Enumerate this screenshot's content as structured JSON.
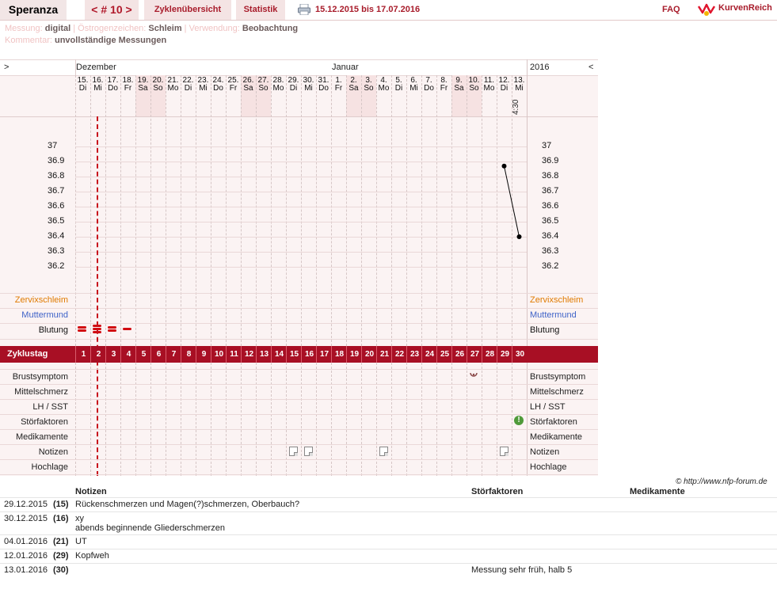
{
  "nav": {
    "brand": "Speranza",
    "cycle": "< # 10 >",
    "tabs": [
      "Zyklenübersicht",
      "Statistik"
    ],
    "date_range": "15.12.2015 bis 17.07.2016",
    "faq": "FAQ",
    "logo_text": "KurvenReich"
  },
  "info": {
    "messung_label": "Messung:",
    "messung_value": "digital",
    "oestrogen_label": "Östrogenzeichen:",
    "oestrogen_value": "Schleim",
    "verwendung_label": "Verwendung:",
    "verwendung_value": "Beobachtung",
    "kommentar_label": "Kommentar:",
    "kommentar_value": "unvollständige Messungen"
  },
  "chart": {
    "nav_prev": ">",
    "nav_next": "<",
    "month_dec": "Dezember",
    "month_jan": "Januar",
    "year": "2016",
    "time_label": "4:30",
    "days": [
      {
        "d": "15.",
        "w": "Di"
      },
      {
        "d": "16.",
        "w": "Mi"
      },
      {
        "d": "17.",
        "w": "Do"
      },
      {
        "d": "18.",
        "w": "Fr"
      },
      {
        "d": "19.",
        "w": "Sa"
      },
      {
        "d": "20.",
        "w": "So"
      },
      {
        "d": "21.",
        "w": "Mo"
      },
      {
        "d": "22.",
        "w": "Di"
      },
      {
        "d": "23.",
        "w": "Mi"
      },
      {
        "d": "24.",
        "w": "Do"
      },
      {
        "d": "25.",
        "w": "Fr"
      },
      {
        "d": "26.",
        "w": "Sa"
      },
      {
        "d": "27.",
        "w": "So"
      },
      {
        "d": "28.",
        "w": "Mo"
      },
      {
        "d": "29.",
        "w": "Di"
      },
      {
        "d": "30.",
        "w": "Mi"
      },
      {
        "d": "31.",
        "w": "Do"
      },
      {
        "d": "1.",
        "w": "Fr"
      },
      {
        "d": "2.",
        "w": "Sa"
      },
      {
        "d": "3.",
        "w": "So"
      },
      {
        "d": "4.",
        "w": "Mo"
      },
      {
        "d": "5.",
        "w": "Di"
      },
      {
        "d": "6.",
        "w": "Mi"
      },
      {
        "d": "7.",
        "w": "Do"
      },
      {
        "d": "8.",
        "w": "Fr"
      },
      {
        "d": "9.",
        "w": "Sa"
      },
      {
        "d": "10.",
        "w": "So"
      },
      {
        "d": "11.",
        "w": "Mo"
      },
      {
        "d": "12.",
        "w": "Di"
      },
      {
        "d": "13.",
        "w": "Mi"
      }
    ],
    "weekend_days": [
      5,
      6,
      12,
      13,
      19,
      20,
      26,
      27
    ],
    "temp_ticks": [
      "37",
      "36.9",
      "36.8",
      "36.7",
      "36.6",
      "36.5",
      "36.4",
      "36.3",
      "36.2"
    ],
    "temperatures": [
      {
        "day": 29,
        "temp": 36.87
      },
      {
        "day": 30,
        "temp": 36.4
      }
    ],
    "row_labels_top": [
      "Zervixschleim",
      "Muttermund",
      "Blutung"
    ],
    "zyklustag_label": "Zyklustag",
    "cycle_days": [
      "1",
      "2",
      "3",
      "4",
      "5",
      "6",
      "7",
      "8",
      "9",
      "10",
      "11",
      "12",
      "13",
      "14",
      "15",
      "16",
      "17",
      "18",
      "19",
      "20",
      "21",
      "22",
      "23",
      "24",
      "25",
      "26",
      "27",
      "28",
      "29",
      "30"
    ],
    "row_labels_bottom": [
      "Brustsymptom",
      "Mittelschmerz",
      "LH / SST",
      "Störfaktoren",
      "Medikamente",
      "Notizen",
      "Hochlage"
    ],
    "bleeding": [
      {
        "day": 1,
        "level": 2
      },
      {
        "day": 2,
        "level": 3
      },
      {
        "day": 3,
        "level": 2
      },
      {
        "day": 4,
        "level": 1
      }
    ],
    "notes_days": [
      15,
      16,
      21,
      29
    ],
    "brust_days": [
      27
    ],
    "stoer_days": [
      30
    ],
    "color_orange": "#e07b00",
    "color_blue": "#3f63c8",
    "color_accent": "#a80f24"
  },
  "copyright": "© http://www.nfp-forum.de",
  "table": {
    "headers": {
      "notizen": "Notizen",
      "stoerfaktoren": "Störfaktoren",
      "medikamente": "Medikamente"
    },
    "rows": [
      {
        "date": "29.12.2015",
        "day": "(15)",
        "note": "Rückenschmerzen und Magen(?)schmerzen, Oberbauch?",
        "note2": "",
        "stoer": ""
      },
      {
        "date": "30.12.2015",
        "day": "(16)",
        "note": "xy",
        "note2": "abends beginnende Gliederschmerzen",
        "stoer": ""
      },
      {
        "date": "04.01.2016",
        "day": "(21)",
        "note": "UT",
        "note2": "",
        "stoer": ""
      },
      {
        "date": "12.01.2016",
        "day": "(29)",
        "note": "Kopfweh",
        "note2": "",
        "stoer": ""
      },
      {
        "date": "13.01.2016",
        "day": "(30)",
        "note": "",
        "note2": "",
        "stoer": "Messung sehr früh, halb 5"
      }
    ]
  }
}
